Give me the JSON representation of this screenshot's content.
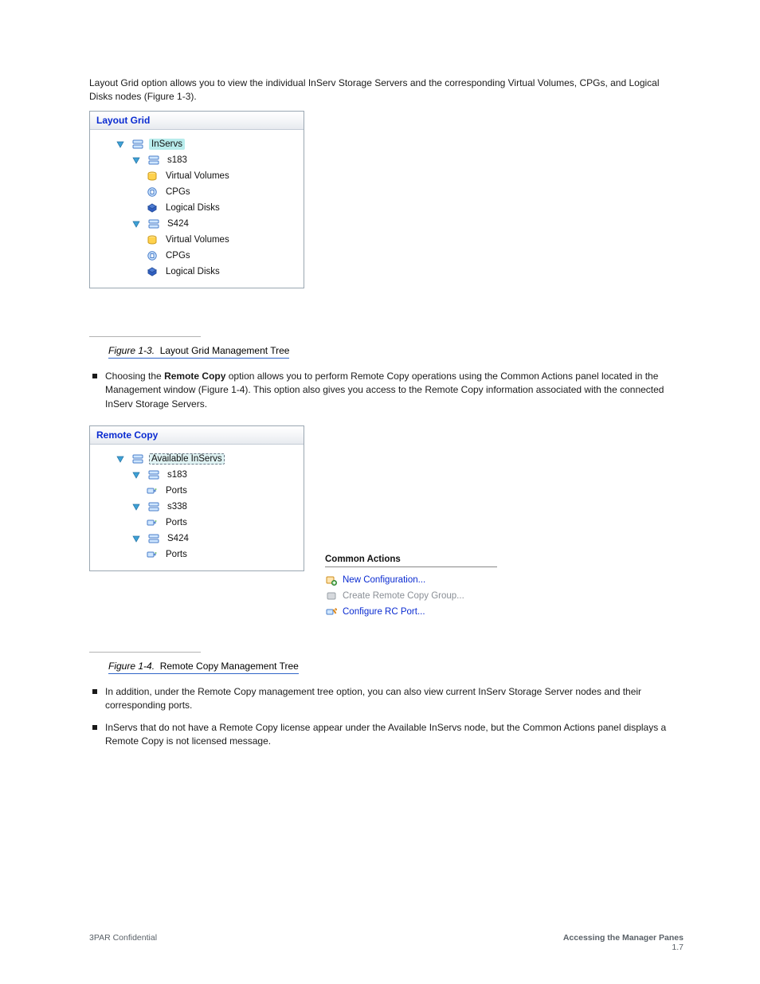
{
  "intro_paragraph": "Layout Grid option allows you to view the individual InServ Storage Servers and the corresponding Virtual Volumes, CPGs, and Logical Disks nodes (Figure 1-3).",
  "layout_grid": {
    "title": "Layout Grid",
    "root": "InServs",
    "servers": [
      {
        "name": "s183",
        "children": [
          "Virtual Volumes",
          "CPGs",
          "Logical Disks"
        ]
      },
      {
        "name": "S424",
        "children": [
          "Virtual Volumes",
          "CPGs",
          "Logical Disks"
        ]
      }
    ]
  },
  "caption_1": {
    "figure": "Figure 1-3.",
    "text": "Layout Grid Management Tree"
  },
  "bullet_2_pre": "Choosing the ",
  "bullet_2_bold": "Remote Copy",
  "bullet_2_post": " option allows you to perform Remote Copy operations using the Common Actions panel located in the Management window (Figure 1-4). This option also gives you access to the Remote Copy information associated with the connected InServ Storage Servers.",
  "remote_copy": {
    "title": "Remote Copy",
    "root": "Available InServs",
    "servers": [
      {
        "name": "s183",
        "child": "Ports"
      },
      {
        "name": "s338",
        "child": "Ports"
      },
      {
        "name": "S424",
        "child": "Ports"
      }
    ]
  },
  "common_actions": {
    "title": "Common Actions",
    "items": [
      {
        "label": "New Configuration...",
        "enabled": true
      },
      {
        "label": "Create Remote Copy Group...",
        "enabled": false
      },
      {
        "label": "Configure RC Port...",
        "enabled": true
      }
    ]
  },
  "caption_2": {
    "figure": "Figure 1-4.",
    "text": "Remote Copy Management Tree"
  },
  "bullet_3": "In addition, under the Remote Copy management tree option, you can also view current InServ Storage Server nodes and their corresponding ports.",
  "bullet_4": "InServs that do not have a Remote Copy license appear under the Available InServs node, but the Common Actions panel displays a Remote Copy is not licensed message.",
  "footer": {
    "left": "3PAR Confidential",
    "right_line1": "Accessing the Manager Panes",
    "right_line2": "1.7"
  }
}
